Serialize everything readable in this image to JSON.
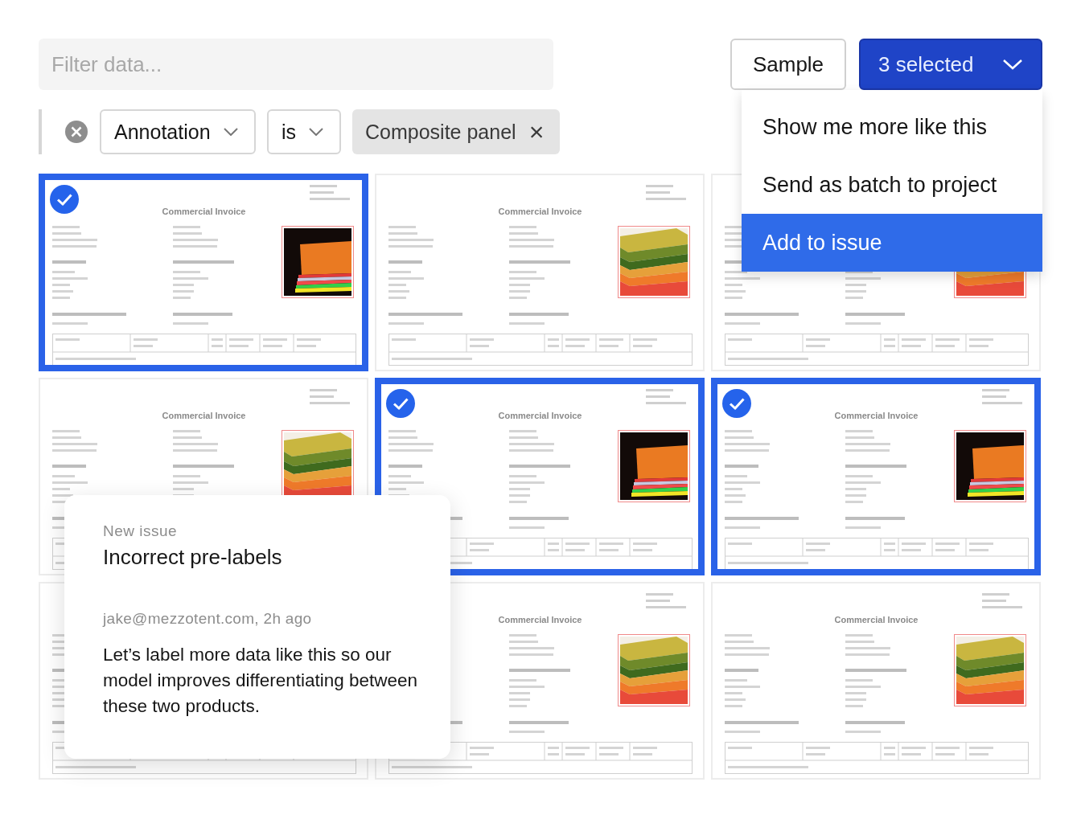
{
  "filter": {
    "placeholder": "Filter data..."
  },
  "buttons": {
    "sample": "Sample",
    "selection": "3 selected"
  },
  "condition": {
    "field": "Annotation",
    "operator": "is",
    "value": "Composite panel",
    "remove": "×"
  },
  "cards": [
    {
      "selected": true,
      "kind": "sheets",
      "title": "Commercial Invoice"
    },
    {
      "selected": false,
      "kind": "stack",
      "title": "Commercial Invoice"
    },
    {
      "selected": false,
      "kind": "stack"
    },
    {
      "selected": false,
      "kind": "stack",
      "title": "Commercial Invoice"
    },
    {
      "selected": true,
      "kind": "sheets",
      "title": "Commercial Invoice"
    },
    {
      "selected": true,
      "kind": "sheets",
      "title": "Commercial Invoice"
    },
    {
      "selected": false
    },
    {
      "selected": false,
      "kind": "stack",
      "title": "Commercial Invoice"
    },
    {
      "selected": false,
      "kind": "stack",
      "title": "Commercial Invoice"
    }
  ],
  "menu": [
    {
      "label": "Show me more like this",
      "selected": false
    },
    {
      "label": "Send as batch to project",
      "selected": false
    },
    {
      "label": "Add to issue",
      "selected": true
    }
  ],
  "issue": {
    "overline": "New issue",
    "title": "Incorrect pre-labels",
    "author": "jake@mezzotent.com, 2h ago",
    "body": "Let’s label more data like this so our model improves differentiating between these two products."
  }
}
